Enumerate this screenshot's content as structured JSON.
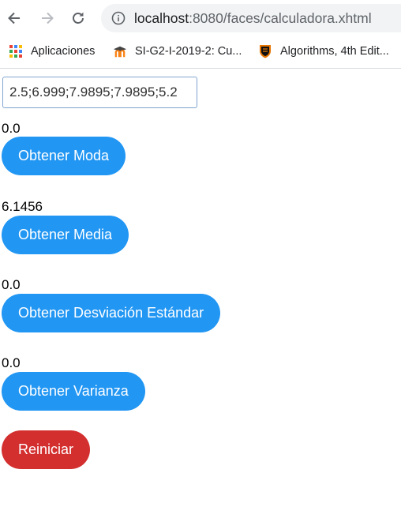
{
  "browser": {
    "url_host": "localhost",
    "url_path": ":8080/faces/calculadora.xhtml",
    "bookmarks": [
      {
        "label": "Aplicaciones",
        "icon": "apps-grid-icon"
      },
      {
        "label": "SI-G2-I-2019-2: Cu...",
        "icon": "moodle-icon"
      },
      {
        "label": "Algorithms, 4th Edit...",
        "icon": "princeton-shield-icon"
      }
    ]
  },
  "calculator": {
    "input_value": "2.5;6.999;7.9895;7.9895;5.2",
    "mode_result": "0.0",
    "mode_button": "Obtener Moda",
    "mean_result": "6.1456",
    "mean_button": "Obtener Media",
    "stddev_result": "0.0",
    "stddev_button": "Obtener Desviación Estándar",
    "variance_result": "0.0",
    "variance_button": "Obtener Varianza",
    "reset_button": "Reiniciar"
  },
  "colors": {
    "primary_button": "#2196f3",
    "reset_button": "#d32f2f"
  }
}
